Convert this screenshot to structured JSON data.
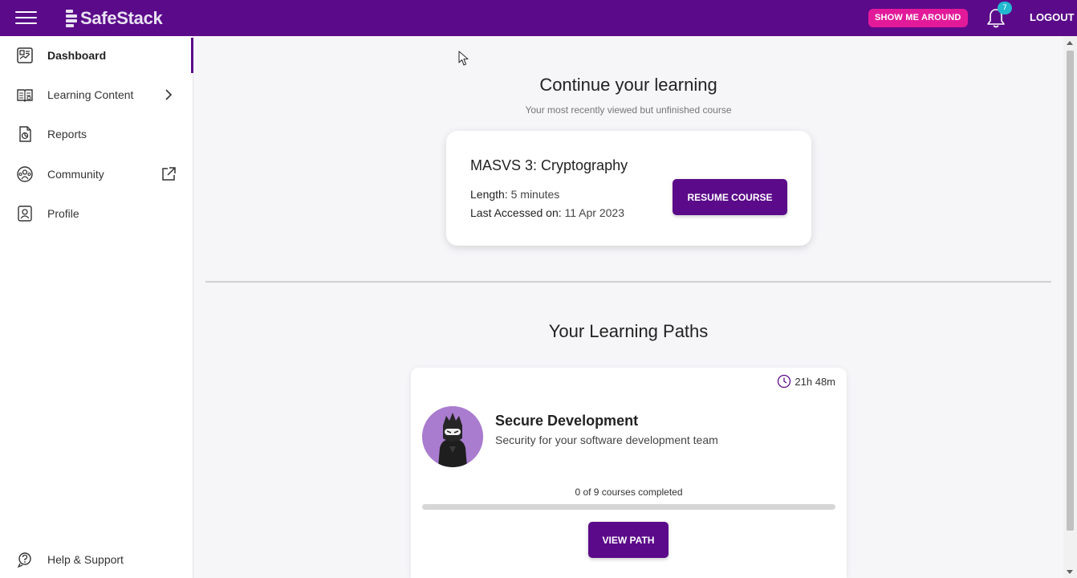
{
  "header": {
    "brand": "SafeStack",
    "tour_label": "SHOW ME AROUND",
    "notifications_count": "7",
    "logout_label": "LOGOUT"
  },
  "sidebar": {
    "items": [
      {
        "label": "Dashboard",
        "icon": "dashboard-icon",
        "active": true
      },
      {
        "label": "Learning Content",
        "icon": "book-icon",
        "trail": "chevron-right-icon"
      },
      {
        "label": "Reports",
        "icon": "report-icon"
      },
      {
        "label": "Community",
        "icon": "community-icon",
        "trail": "external-link-icon"
      },
      {
        "label": "Profile",
        "icon": "profile-icon"
      }
    ],
    "help_label": "Help & Support"
  },
  "continue": {
    "title": "Continue your learning",
    "subtitle": "Your most recently viewed but unfinished course",
    "course": {
      "name": "MASVS 3: Cryptography",
      "length_label": "Length:",
      "length_value": " 5 minutes",
      "accessed_label": "Last Accessed on:",
      "accessed_value": " 11 Apr 2023",
      "resume_label": "RESUME COURSE"
    }
  },
  "paths": {
    "title": "Your Learning Paths",
    "items": [
      {
        "duration": "21h 48m",
        "name": "Secure Development",
        "description": "Security for your software development team",
        "progress_text": "0 of 9 courses completed",
        "progress_fraction": 0,
        "view_label": "VIEW PATH"
      }
    ]
  },
  "colors": {
    "primary": "#5b0a8a",
    "accent": "#e21a9a",
    "badge": "#22b8cf"
  }
}
